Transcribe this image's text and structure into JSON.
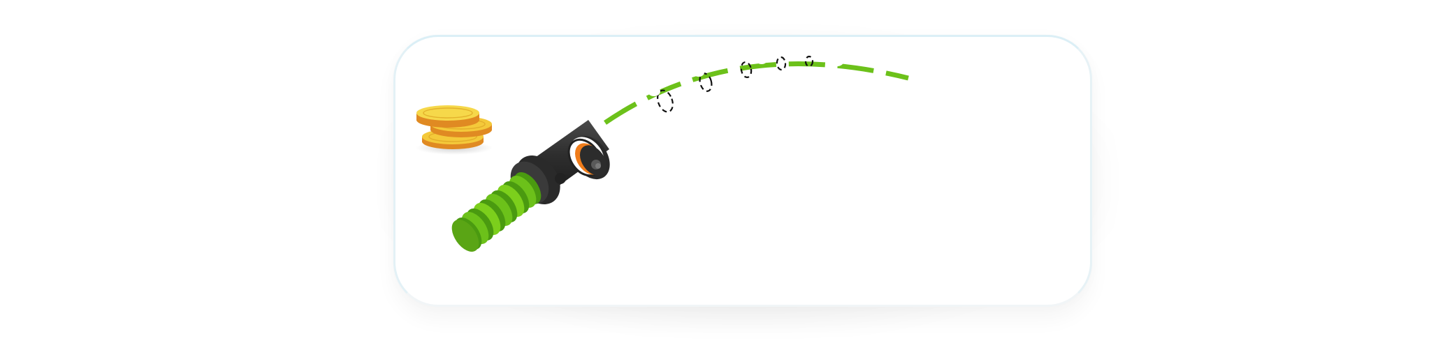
{
  "game": {
    "scene": "cannon-launch",
    "icons": {
      "coins": "coin-stack-icon",
      "cannon": "cannon-icon",
      "spring": "spring-icon",
      "trajectory": "trajectory-arc"
    },
    "colors": {
      "accent_green": "#6cc11a",
      "dark_green": "#4a9a10",
      "cannon_dark": "#2e2e2e",
      "ring_orange": "#f07c1a",
      "coin_gold": "#f4d03f",
      "coin_edge": "#e39a2c",
      "card_border": "#dbeff6"
    }
  }
}
